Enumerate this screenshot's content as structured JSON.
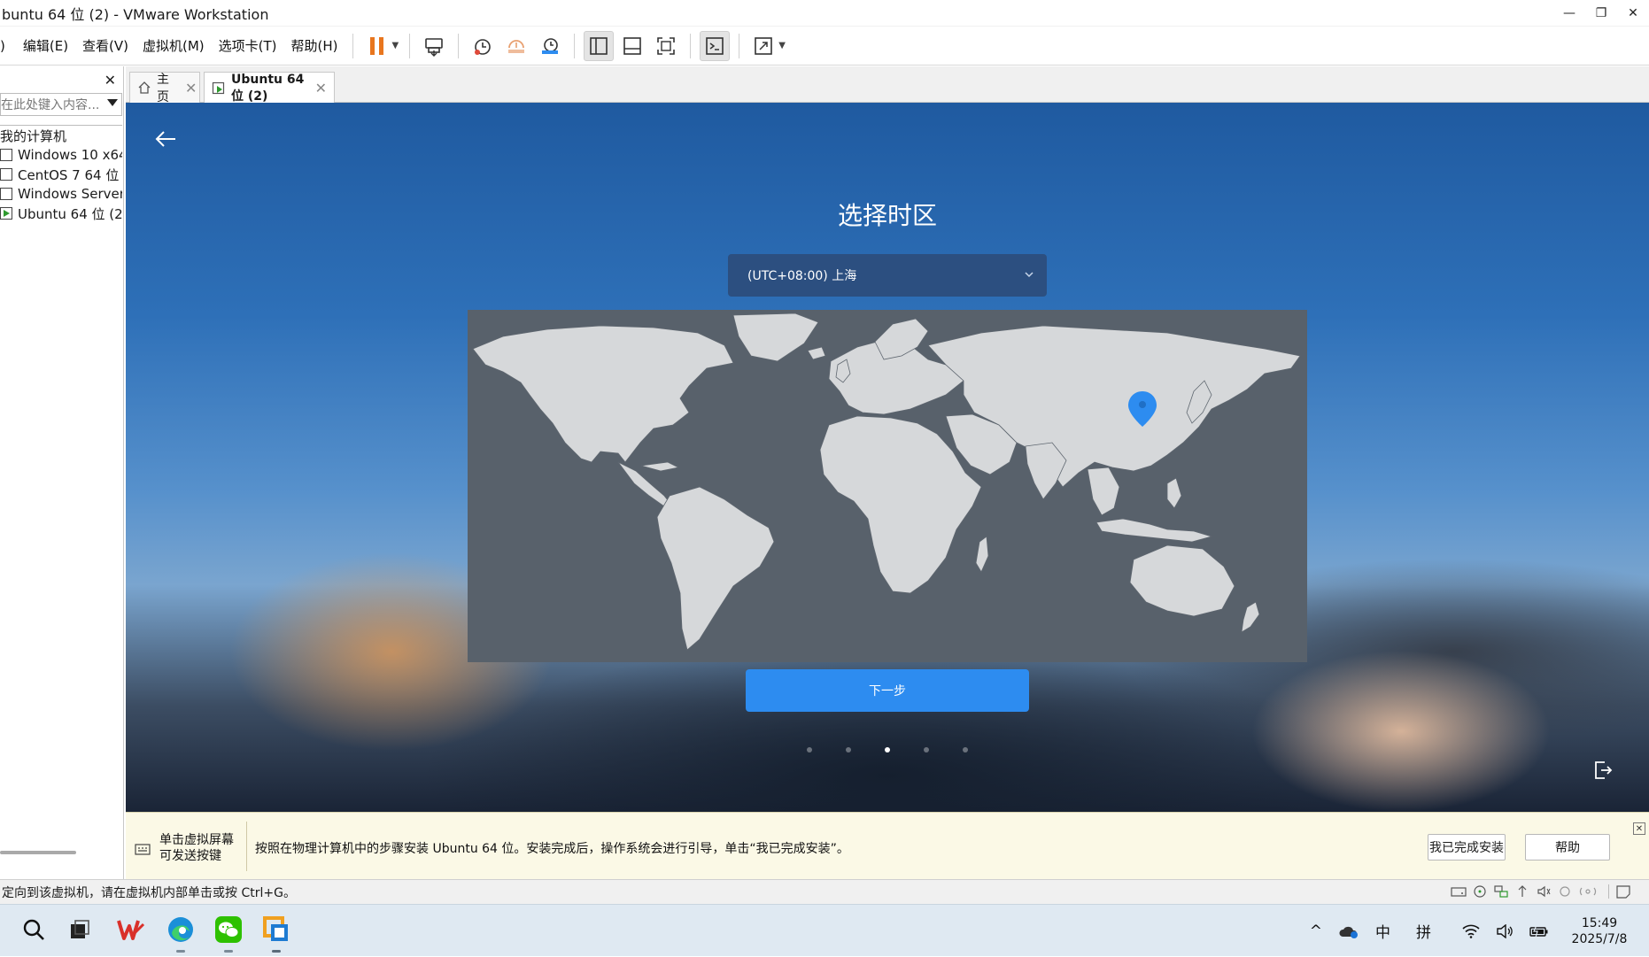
{
  "window": {
    "title": "buntu 64 位 (2) - VMware Workstation",
    "minimize_glyph": "—",
    "restore_glyph": "❐",
    "close_glyph": "✕"
  },
  "menu": {
    "items": [
      ")",
      "编辑(E)",
      "查看(V)",
      "虚拟机(M)",
      "选项卡(T)",
      "帮助(H)"
    ]
  },
  "toolbar": {
    "icons": [
      "pause-icon",
      "send-keys-icon",
      "snapshot-icon",
      "revert-snapshot-icon",
      "snapshot-manager-icon",
      "show-library-icon",
      "thumbnail-bar-icon",
      "full-screen-icon",
      "console-view-icon",
      "stretch-icon"
    ]
  },
  "sidebar": {
    "close_glyph": "✕",
    "search_placeholder": "在此处键入内容...",
    "tree": {
      "root": "我的计算机",
      "items": [
        {
          "label": "Windows 10 x64",
          "running": false
        },
        {
          "label": "CentOS 7 64 位",
          "running": false
        },
        {
          "label": "Windows Server",
          "running": false
        },
        {
          "label": "Ubuntu 64 位 (2)",
          "running": true
        }
      ]
    }
  },
  "tabs": [
    {
      "label": "主页",
      "icon": "home-icon",
      "active": false
    },
    {
      "label": "Ubuntu 64 位 (2)",
      "icon": "vm-running-icon",
      "active": true
    }
  ],
  "installer": {
    "title": "选择时区",
    "timezone_value": "(UTC+08:00) 上海",
    "next_label": "下一步",
    "steps_total": 5,
    "current_step": 3,
    "selected_location": "上海"
  },
  "hint": {
    "left_line1": "单击虚拟屏幕",
    "left_line2": "可发送按键",
    "message": "按照在物理计算机中的步骤安装 Ubuntu 64 位。安装完成后，操作系统会进行引导，单击“我已完成安装”。",
    "done_button": "我已完成安装",
    "help_button": "帮助",
    "close_glyph": "✕"
  },
  "status": {
    "text": "定向到该虚拟机，请在虚拟机内部单击或按 Ctrl+G。"
  },
  "taskbar": {
    "apps": [
      "search-icon",
      "task-view-icon",
      "wps-icon",
      "edge-icon",
      "wechat-icon",
      "vmware-icon"
    ],
    "tray": {
      "chevron": "^",
      "ime_lang": "中",
      "ime_mode": "拼",
      "time": "15:49",
      "date": "2025/7/8"
    }
  },
  "colors": {
    "accent_blue": "#2d8cf0",
    "select_bg": "#2c4f80",
    "map_water": "#58616b",
    "map_land": "#d6d8da",
    "pin": "#2d8cf0",
    "hint_bg": "#fbf9e6"
  }
}
